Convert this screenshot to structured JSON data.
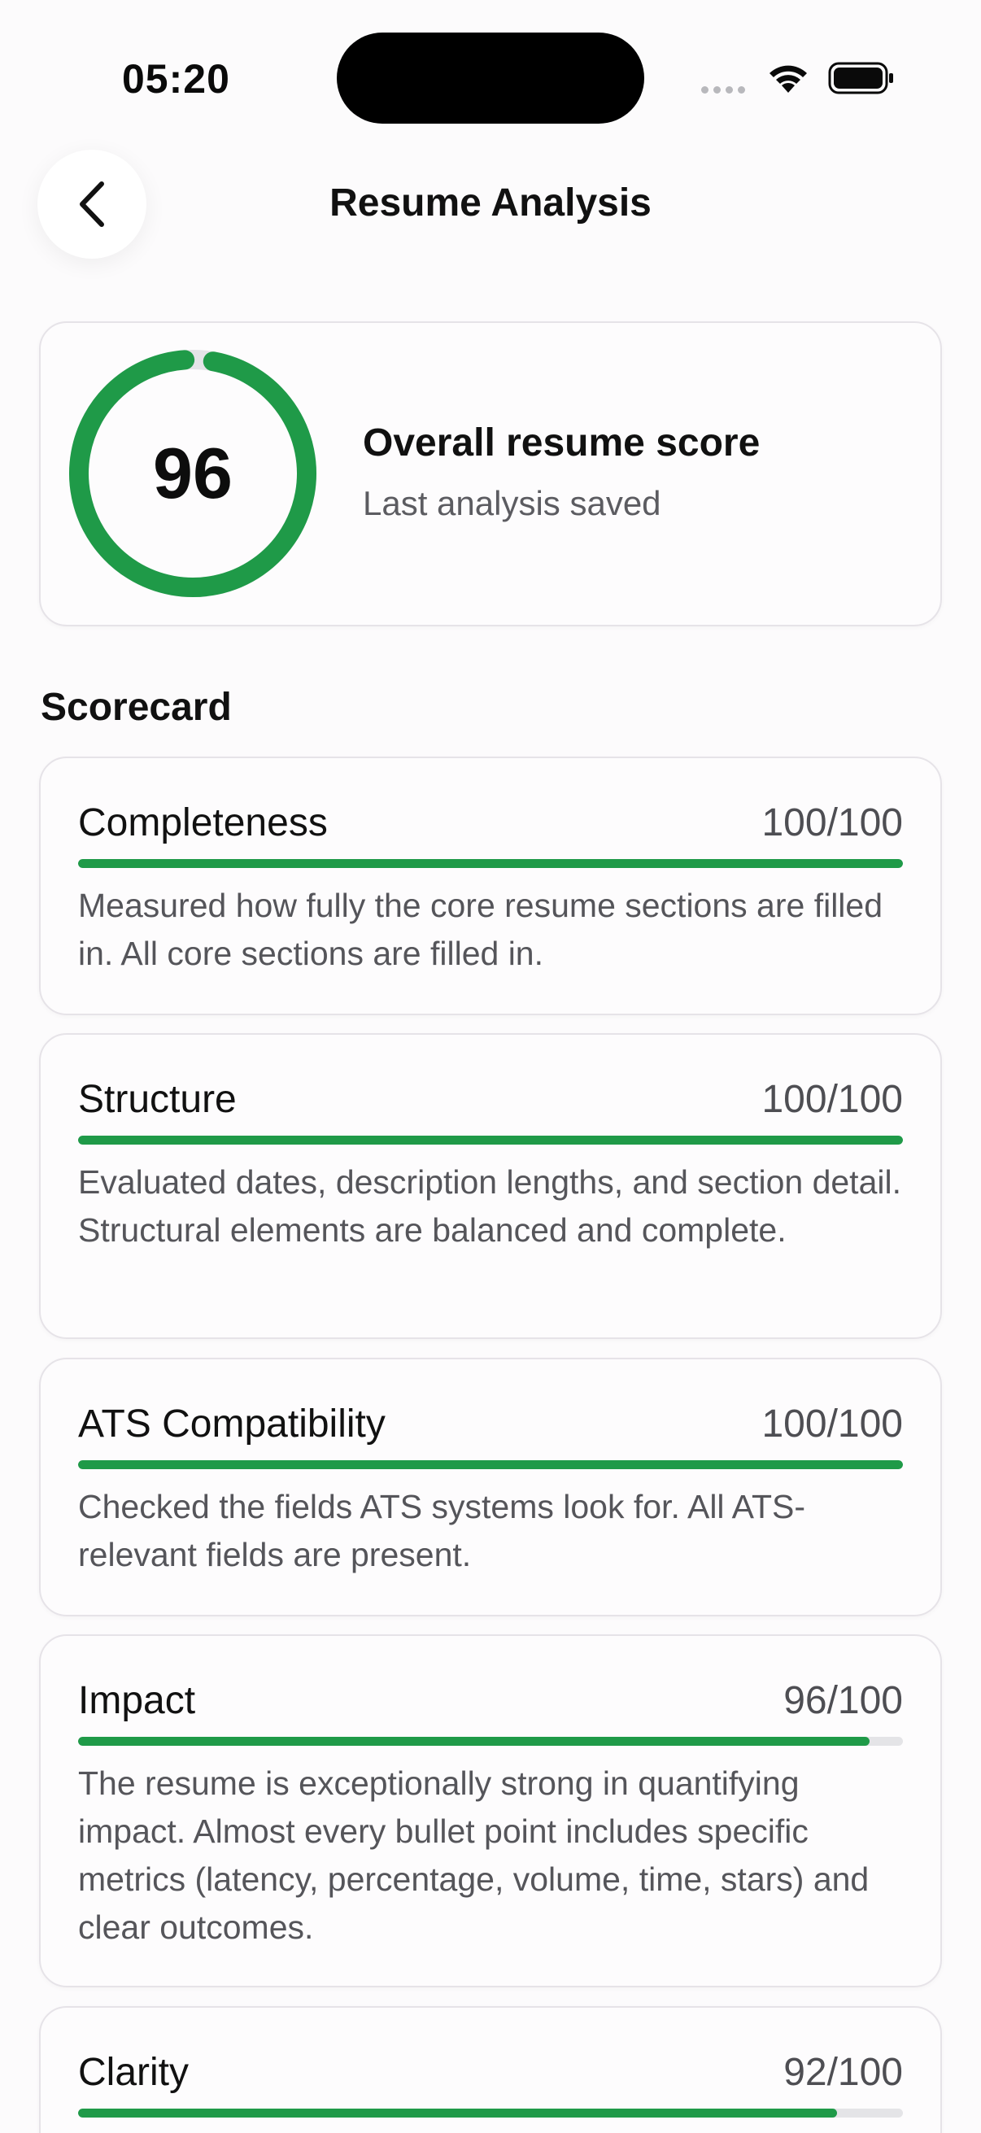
{
  "status_bar": {
    "time": "05:20"
  },
  "header": {
    "title": "Resume Analysis",
    "back_icon": "chevron-left-icon"
  },
  "overall": {
    "score": "96",
    "score_fraction": 0.96,
    "heading": "Overall resume score",
    "subtitle": "Last analysis saved",
    "ring_color": "#1f9a48"
  },
  "scorecard": {
    "title": "Scorecard",
    "accent_color": "#1f9a48",
    "items": [
      {
        "name": "Completeness",
        "score": "100/100",
        "fraction": 1.0,
        "description": "Measured how fully the core resume sections are filled in. All core sections are filled in."
      },
      {
        "name": "Structure",
        "score": "100/100",
        "fraction": 1.0,
        "description": "Evaluated dates, description lengths, and section detail. Structural elements are balanced and complete."
      },
      {
        "name": "ATS Compatibility",
        "score": "100/100",
        "fraction": 1.0,
        "description": "Checked the fields ATS systems look for. All ATS-relevant fields are present."
      },
      {
        "name": "Impact",
        "score": "96/100",
        "fraction": 0.96,
        "description": "The resume is exceptionally strong in quantifying impact. Almost every bullet point includes specific metrics (latency, percentage, volume, time, stars) and clear outcomes."
      },
      {
        "name": "Clarity",
        "score": "92/100",
        "fraction": 0.92,
        "description": ""
      }
    ]
  }
}
